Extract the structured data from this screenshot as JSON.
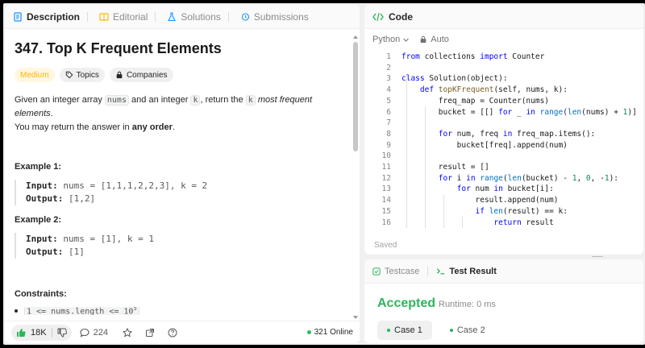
{
  "left_tabs": [
    {
      "label": "Description",
      "active": true
    },
    {
      "label": "Editorial"
    },
    {
      "label": "Solutions"
    },
    {
      "label": "Submissions"
    }
  ],
  "problem": {
    "title": "347. Top K Frequent Elements",
    "difficulty": "Medium",
    "topics_label": "Topics",
    "companies_label": "Companies",
    "desc_1": "Given an integer array ",
    "desc_code_1": "nums",
    "desc_2": " and an integer ",
    "desc_code_2": "k",
    "desc_3": ", return the ",
    "desc_code_3": "k",
    "desc_4": " most frequent elements",
    "desc_5": ".",
    "desc_6": "You may return the answer in ",
    "desc_7": "any order",
    "desc_8": "."
  },
  "examples": [
    {
      "title": "Example 1:",
      "input_label": "Input:",
      "input": " nums = [1,1,1,2,2,3], k = 2",
      "output_label": "Output:",
      "output": " [1,2]"
    },
    {
      "title": "Example 2:",
      "input_label": "Input:",
      "input": " nums = [1], k = 1",
      "output_label": "Output:",
      "output": " [1]"
    }
  ],
  "constraints": {
    "title": "Constraints:",
    "first_item": "1 <= nums.length <= 10",
    "first_item_exp": "5"
  },
  "footer": {
    "likes": "18K",
    "comments": "224",
    "online": "321 Online"
  },
  "code_panel": {
    "title": "Code",
    "language": "Python",
    "mode": "Auto",
    "saved": "Saved",
    "lines": [
      "from collections import Counter",
      "",
      "class Solution(object):",
      "    def topKFrequent(self, nums, k):",
      "        freq_map = Counter(nums)",
      "        bucket = [[] for _ in range(len(nums) + 1)]",
      "",
      "        for num, freq in freq_map.items():",
      "            bucket[freq].append(num)",
      "",
      "        result = []",
      "        for i in range(len(bucket) - 1, 0, -1):",
      "            for num in bucket[i]:",
      "                result.append(num)",
      "                if len(result) == k:",
      "                    return result"
    ]
  },
  "result_panel": {
    "tabs": [
      {
        "label": "Testcase"
      },
      {
        "label": "Test Result",
        "active": true
      }
    ],
    "status": "Accepted",
    "runtime": "Runtime: 0 ms",
    "cases": [
      {
        "label": "Case 1",
        "active": true
      },
      {
        "label": "Case 2"
      }
    ]
  },
  "colors": {
    "accepted": "#2db55d",
    "medium": "#ffb800",
    "keyword": "#0000ff"
  }
}
